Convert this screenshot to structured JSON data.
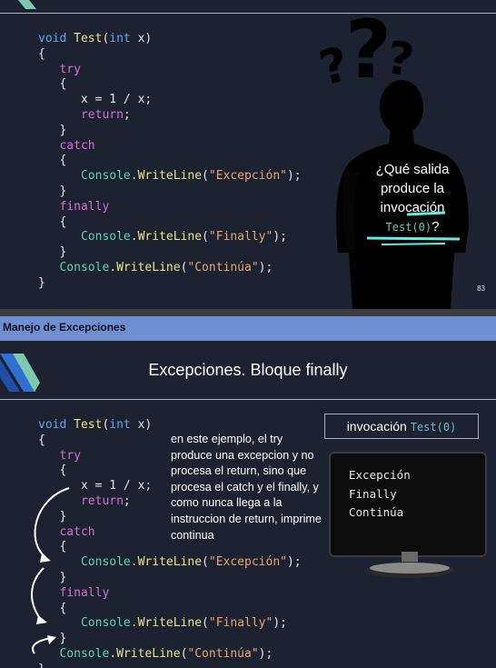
{
  "slide1": {
    "page_number": "83",
    "question": {
      "text": "¿Qué salida produce la invocación",
      "code": "Test(0)",
      "suffix": "?"
    },
    "code_lines": [
      [
        {
          "t": "void ",
          "c": "kw"
        },
        {
          "t": "Test",
          "c": "fn"
        },
        {
          "t": "(",
          "c": ""
        },
        {
          "t": "int",
          "c": "kw"
        },
        {
          "t": " x)",
          "c": ""
        }
      ],
      [
        {
          "t": "{",
          "c": ""
        }
      ],
      [
        {
          "t": "   try",
          "c": "kw2"
        }
      ],
      [
        {
          "t": "   {",
          "c": ""
        }
      ],
      [
        {
          "t": "      x = 1 / x;",
          "c": ""
        }
      ],
      [
        {
          "t": "      return",
          "c": "kw2"
        },
        {
          "t": ";",
          "c": ""
        }
      ],
      [
        {
          "t": "   }",
          "c": ""
        }
      ],
      [
        {
          "t": "   catch",
          "c": "kw2"
        }
      ],
      [
        {
          "t": "   {",
          "c": ""
        }
      ],
      [
        {
          "t": "      ",
          "c": ""
        },
        {
          "t": "Console",
          "c": "cls"
        },
        {
          "t": ".",
          "c": ""
        },
        {
          "t": "WriteLine",
          "c": "fn"
        },
        {
          "t": "(",
          "c": ""
        },
        {
          "t": "\"Excepción\"",
          "c": "str"
        },
        {
          "t": ");",
          "c": ""
        }
      ],
      [
        {
          "t": "   }",
          "c": ""
        }
      ],
      [
        {
          "t": "   finally",
          "c": "kw2"
        }
      ],
      [
        {
          "t": "   {",
          "c": ""
        }
      ],
      [
        {
          "t": "      ",
          "c": ""
        },
        {
          "t": "Console",
          "c": "cls"
        },
        {
          "t": ".",
          "c": ""
        },
        {
          "t": "WriteLine",
          "c": "fn"
        },
        {
          "t": "(",
          "c": ""
        },
        {
          "t": "\"Finally\"",
          "c": "str"
        },
        {
          "t": ");",
          "c": ""
        }
      ],
      [
        {
          "t": "   }",
          "c": ""
        }
      ],
      [
        {
          "t": "   ",
          "c": ""
        },
        {
          "t": "Console",
          "c": "cls"
        },
        {
          "t": ".",
          "c": ""
        },
        {
          "t": "WriteLine",
          "c": "fn"
        },
        {
          "t": "(",
          "c": ""
        },
        {
          "t": "\"Continúa\"",
          "c": "str"
        },
        {
          "t": ");",
          "c": ""
        }
      ],
      [
        {
          "t": "}",
          "c": ""
        }
      ]
    ]
  },
  "section_bar": {
    "title": "Manejo de Excepciones"
  },
  "slide2": {
    "title": "Excepciones. Bloque finally",
    "invocation": {
      "label": "invocación",
      "code": "Test(0)"
    },
    "explanation": "en este ejemplo, el try produce una excepcion y no procesa el return, sino que procesa el catch y el finally, y como nunca llega a la instruccion de return, imprime continua",
    "screen_output": [
      "Excepción",
      "Finally",
      "Continúa"
    ],
    "code_lines": [
      [
        {
          "t": "void ",
          "c": "kw"
        },
        {
          "t": "Test",
          "c": "fn"
        },
        {
          "t": "(",
          "c": ""
        },
        {
          "t": "int",
          "c": "kw"
        },
        {
          "t": " x)",
          "c": ""
        }
      ],
      [
        {
          "t": "{",
          "c": ""
        }
      ],
      [
        {
          "t": "   try",
          "c": "kw2"
        }
      ],
      [
        {
          "t": "   {",
          "c": ""
        }
      ],
      [
        {
          "t": "      x = 1 / x;",
          "c": ""
        }
      ],
      [
        {
          "t": "      return",
          "c": "kw2"
        },
        {
          "t": ";",
          "c": ""
        }
      ],
      [
        {
          "t": "   }",
          "c": ""
        }
      ],
      [
        {
          "t": "   catch",
          "c": "kw2"
        }
      ],
      [
        {
          "t": "   {",
          "c": ""
        }
      ],
      [
        {
          "t": "      ",
          "c": ""
        },
        {
          "t": "Console",
          "c": "cls"
        },
        {
          "t": ".",
          "c": ""
        },
        {
          "t": "WriteLine",
          "c": "fn"
        },
        {
          "t": "(",
          "c": ""
        },
        {
          "t": "\"Excepción\"",
          "c": "str"
        },
        {
          "t": ");",
          "c": ""
        }
      ],
      [
        {
          "t": "   }",
          "c": ""
        }
      ],
      [
        {
          "t": "   finally",
          "c": "kw2"
        }
      ],
      [
        {
          "t": "   {",
          "c": ""
        }
      ],
      [
        {
          "t": "      ",
          "c": ""
        },
        {
          "t": "Console",
          "c": "cls"
        },
        {
          "t": ".",
          "c": ""
        },
        {
          "t": "WriteLine",
          "c": "fn"
        },
        {
          "t": "(",
          "c": ""
        },
        {
          "t": "\"Finally\"",
          "c": "str"
        },
        {
          "t": ");",
          "c": ""
        }
      ],
      [
        {
          "t": "   }",
          "c": ""
        }
      ],
      [
        {
          "t": "   ",
          "c": ""
        },
        {
          "t": "Console",
          "c": "cls"
        },
        {
          "t": ".",
          "c": ""
        },
        {
          "t": "WriteLine",
          "c": "fn"
        },
        {
          "t": "(",
          "c": ""
        },
        {
          "t": "\"Continúa\"",
          "c": "str"
        },
        {
          "t": ");",
          "c": ""
        }
      ],
      [
        {
          "t": "}",
          "c": ""
        }
      ]
    ]
  },
  "colors": {
    "slide_bg": "#1d2230",
    "section_bar": "#6f8fd0",
    "keyword": "#5fa6ee",
    "control": "#d070d8",
    "string": "#e4a777",
    "type": "#5fd2b0"
  },
  "icons": [
    "question-marks-icon",
    "thinking-person-silhouette",
    "corner-ribbon-logo",
    "monitor-icon",
    "flow-arrow-icon"
  ]
}
